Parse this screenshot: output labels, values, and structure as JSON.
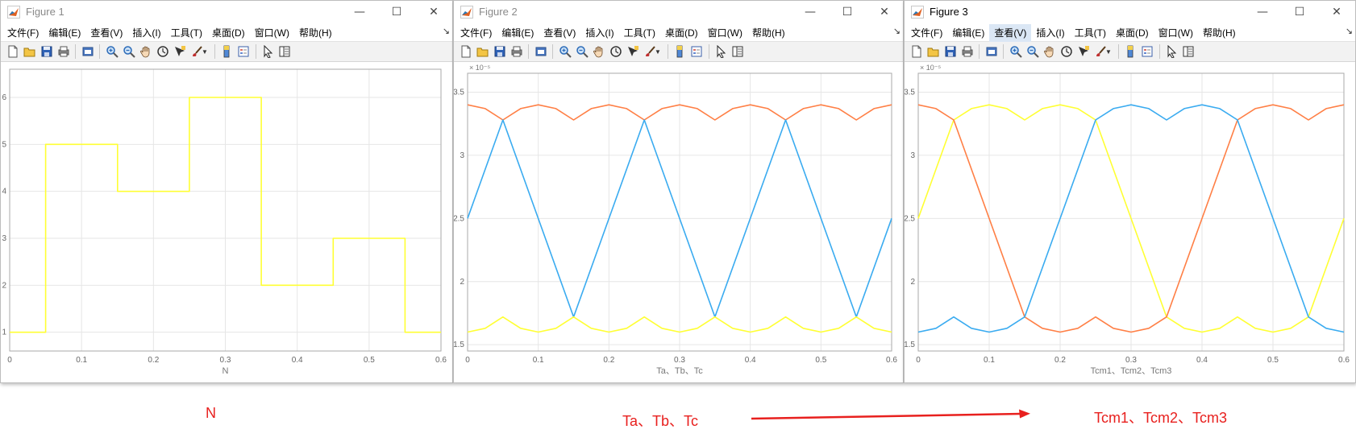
{
  "figures": [
    {
      "title": "Figure 1",
      "menu": [
        "文件(F)",
        "编辑(E)",
        "查看(V)",
        "插入(I)",
        "工具(T)",
        "桌面(D)",
        "窗口(W)",
        "帮助(H)"
      ],
      "active_menu": ""
    },
    {
      "title": "Figure 2",
      "menu": [
        "文件(F)",
        "编辑(E)",
        "查看(V)",
        "插入(I)",
        "工具(T)",
        "桌面(D)",
        "窗口(W)",
        "帮助(H)"
      ],
      "active_menu": ""
    },
    {
      "title": "Figure 3",
      "menu": [
        "文件(F)",
        "编辑(E)",
        "查看(V)",
        "插入(I)",
        "工具(T)",
        "桌面(D)",
        "窗口(W)",
        "帮助(H)"
      ],
      "active_menu": "查看(V)"
    }
  ],
  "window_controls": {
    "minimize": "—",
    "maximize": "☐",
    "close": "✕",
    "more": "↘"
  },
  "toolbar_icons": [
    "new-file-icon",
    "open-folder-icon",
    "save-icon",
    "print-icon",
    "print-preview-icon",
    "zoom-in-icon",
    "zoom-out-icon",
    "pan-hand-icon",
    "rotate-3d-icon",
    "data-cursor-icon",
    "brush-icon",
    "colorbar-icon",
    "legend-icon",
    "edit-plot-arrow-icon",
    "property-inspector-icon"
  ],
  "colors": {
    "yellow": "#ffff33",
    "blue": "#3aabf0",
    "orange": "#ff7f45",
    "annotation": "#e8201e",
    "grid": "#e6e6e6",
    "axis": "#aaaaaa"
  },
  "annotations": {
    "n": "N",
    "t": "Ta、Tb、Tc",
    "tcm": "Tcm1、Tcm2、Tcm3"
  },
  "chart_data": [
    {
      "type": "line",
      "xlabel": "N",
      "ylabel": "",
      "xlim": [
        0,
        0.6
      ],
      "ylim": [
        0.6,
        6.6
      ],
      "x_ticks": [
        "0",
        "0.1",
        "0.2",
        "0.3",
        "0.4",
        "0.5",
        "0.6"
      ],
      "y_ticks": [
        "1",
        "2",
        "3",
        "4",
        "5",
        "6"
      ],
      "grid": true,
      "series": [
        {
          "color": "yellow",
          "step": true,
          "x": [
            0,
            0.05,
            0.05,
            0.15,
            0.15,
            0.25,
            0.25,
            0.35,
            0.35,
            0.45,
            0.45,
            0.55,
            0.55,
            0.6
          ],
          "y": [
            1,
            1,
            5,
            5,
            4,
            4,
            6,
            6,
            2,
            2,
            3,
            3,
            1,
            1
          ]
        }
      ]
    },
    {
      "type": "line",
      "xlabel": "Ta、Tb、Tc",
      "ylabel": "",
      "exponent": "× 10⁻⁵",
      "xlim": [
        0,
        0.6
      ],
      "ylim": [
        1.45,
        3.65
      ],
      "x_ticks": [
        "0",
        "0.1",
        "0.2",
        "0.3",
        "0.4",
        "0.5",
        "0.6"
      ],
      "y_ticks": [
        "1.5",
        "2",
        "2.5",
        "3",
        "3.5"
      ],
      "grid": true,
      "series": [
        {
          "color": "orange",
          "x": [
            0,
            0.025,
            0.05,
            0.075,
            0.1,
            0.125,
            0.15,
            0.175,
            0.2,
            0.225,
            0.25,
            0.275,
            0.3,
            0.325,
            0.35,
            0.375,
            0.4,
            0.425,
            0.45,
            0.475,
            0.5,
            0.525,
            0.55,
            0.575,
            0.6
          ],
          "y": [
            3.4,
            3.37,
            3.28,
            3.37,
            3.4,
            3.37,
            3.28,
            3.37,
            3.4,
            3.37,
            3.28,
            3.37,
            3.4,
            3.37,
            3.28,
            3.37,
            3.4,
            3.37,
            3.28,
            3.37,
            3.4,
            3.37,
            3.28,
            3.37,
            3.4
          ]
        },
        {
          "color": "blue",
          "x": [
            0,
            0.05,
            0.15,
            0.25,
            0.35,
            0.45,
            0.55,
            0.6
          ],
          "y": [
            2.5,
            3.28,
            1.72,
            3.28,
            1.72,
            3.28,
            1.72,
            2.5
          ]
        },
        {
          "color": "yellow",
          "x": [
            0,
            0.025,
            0.05,
            0.075,
            0.1,
            0.125,
            0.15,
            0.175,
            0.2,
            0.225,
            0.25,
            0.275,
            0.3,
            0.325,
            0.35,
            0.375,
            0.4,
            0.425,
            0.45,
            0.475,
            0.5,
            0.525,
            0.55,
            0.575,
            0.6
          ],
          "y": [
            1.6,
            1.63,
            1.72,
            1.63,
            1.6,
            1.63,
            1.72,
            1.63,
            1.6,
            1.63,
            1.72,
            1.63,
            1.6,
            1.63,
            1.72,
            1.63,
            1.6,
            1.63,
            1.72,
            1.63,
            1.6,
            1.63,
            1.72,
            1.63,
            1.6
          ]
        }
      ]
    },
    {
      "type": "line",
      "xlabel": "Tcm1、Tcm2、Tcm3",
      "ylabel": "",
      "exponent": "× 10⁻⁵",
      "xlim": [
        0,
        0.6
      ],
      "ylim": [
        1.45,
        3.65
      ],
      "x_ticks": [
        "0",
        "0.1",
        "0.2",
        "0.3",
        "0.4",
        "0.5",
        "0.6"
      ],
      "y_ticks": [
        "1.5",
        "2",
        "2.5",
        "3",
        "3.5"
      ],
      "grid": true,
      "series": [
        {
          "color": "yellow",
          "x": [
            0,
            0.05,
            0.075,
            0.1,
            0.125,
            0.15,
            0.175,
            0.2,
            0.225,
            0.25,
            0.35,
            0.375,
            0.4,
            0.425,
            0.45,
            0.475,
            0.5,
            0.525,
            0.55,
            0.6
          ],
          "y": [
            2.5,
            3.28,
            3.37,
            3.4,
            3.37,
            3.28,
            3.37,
            3.4,
            3.37,
            3.28,
            1.72,
            1.63,
            1.6,
            1.63,
            1.72,
            1.63,
            1.6,
            1.63,
            1.72,
            2.5
          ]
        },
        {
          "color": "orange",
          "x": [
            0,
            0.025,
            0.05,
            0.15,
            0.175,
            0.2,
            0.225,
            0.25,
            0.275,
            0.3,
            0.325,
            0.35,
            0.45,
            0.475,
            0.5,
            0.525,
            0.55,
            0.575,
            0.6
          ],
          "y": [
            3.4,
            3.37,
            3.28,
            1.72,
            1.63,
            1.6,
            1.63,
            1.72,
            1.63,
            1.6,
            1.63,
            1.72,
            3.28,
            3.37,
            3.4,
            3.37,
            3.28,
            3.37,
            3.4
          ]
        },
        {
          "color": "blue",
          "x": [
            0,
            0.025,
            0.05,
            0.075,
            0.1,
            0.125,
            0.15,
            0.25,
            0.275,
            0.3,
            0.325,
            0.35,
            0.375,
            0.4,
            0.425,
            0.45,
            0.55,
            0.575,
            0.6
          ],
          "y": [
            1.6,
            1.63,
            1.72,
            1.63,
            1.6,
            1.63,
            1.72,
            3.28,
            3.37,
            3.4,
            3.37,
            3.28,
            3.37,
            3.4,
            3.37,
            3.28,
            1.72,
            1.63,
            1.6
          ]
        }
      ]
    }
  ]
}
